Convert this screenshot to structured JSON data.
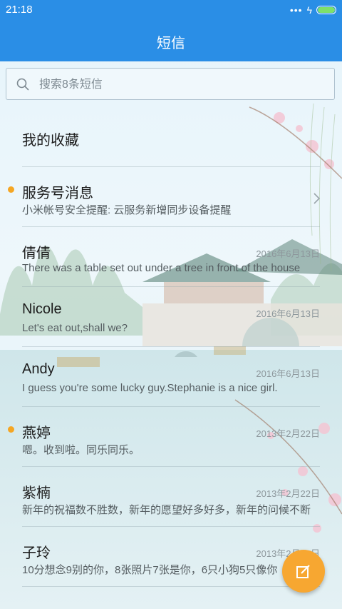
{
  "status_bar": {
    "time": "21:18",
    "dots": "•••",
    "charge": "ϟ"
  },
  "header": {
    "title": "短信"
  },
  "search": {
    "placeholder": "搜索8条短信"
  },
  "favorites": {
    "label": "我的收藏"
  },
  "service": {
    "name": "服务号消息",
    "preview": "小米帐号安全提醒: 云服务新增同步设备提醒"
  },
  "conversations": [
    {
      "name": "倩倩",
      "date": "2016年6月13日",
      "preview": "There was a table set out under a tree in front of the house"
    },
    {
      "name": "Nicole",
      "date": "2016年6月13日",
      "preview": "Let's eat out,shall we?"
    },
    {
      "name": "Andy",
      "date": "2016年6月13日",
      "preview": "I guess you're some lucky guy.Stephanie is a nice girl."
    },
    {
      "name": "燕婷",
      "date": "2013年2月22日",
      "preview": "嗯。收到啦。同乐同乐。"
    },
    {
      "name": "紫楠",
      "date": "2013年2月22日",
      "preview": "新年的祝福数不胜数，新年的愿望好多好多，新年的问候不断"
    },
    {
      "name": "子玲",
      "date": "2013年2月22日",
      "preview": "10分想念9别的你，8张照片7张是你，6只小狗5只像你"
    }
  ],
  "colors": {
    "primary": "#2a8ee6",
    "fab": "#f7a731",
    "unread_dot": "#f5a623"
  },
  "icons": {
    "search": "search-icon",
    "compose": "compose-icon",
    "chevron": "chevron-right-icon"
  }
}
